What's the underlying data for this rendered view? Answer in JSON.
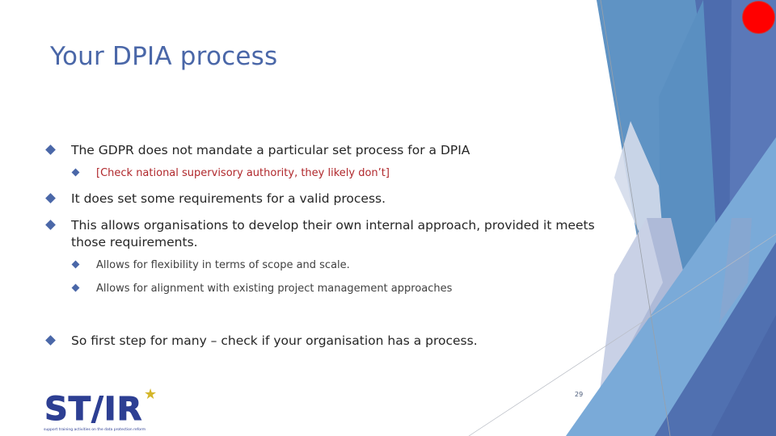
{
  "slide": {
    "title": "Your DPIA process",
    "page_number": "29",
    "bullets": [
      {
        "text": "The GDPR does not mandate a particular set process for a DPIA",
        "sub": [
          {
            "text": "[Check national supervisory authority, they likely don’t]",
            "color": "#b0282c"
          }
        ]
      },
      {
        "text": "It does set some requirements for a valid process.",
        "sub": []
      },
      {
        "text": "This allows organisations to develop their own internal approach, provided it meets those requirements.",
        "sub": [
          {
            "text": "Allows for flexibility in terms of scope and scale."
          },
          {
            "text": "Allows for alignment with existing project management approaches"
          }
        ]
      },
      {
        "text": "So first step for many – check if your organisation has a process.",
        "sub": []
      }
    ]
  },
  "logo": {
    "name": "STAR",
    "wordmark": "ST/IR",
    "star_glyph": "★",
    "tagline": "support training activities on the data protection reform"
  },
  "overlay": {
    "record_indicator": "red-dot"
  },
  "colors": {
    "title": "#4a67a8",
    "bullet": "#4a67a8",
    "accent_red": "#b0282c",
    "record": "#ff0000"
  }
}
